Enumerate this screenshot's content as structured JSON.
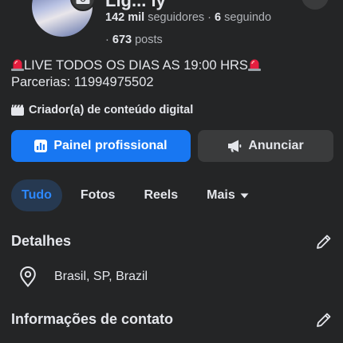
{
  "profile": {
    "name_fragment": "Lig... ly",
    "followers_count": "142 mil",
    "followers_label": "seguidores",
    "separator": "·",
    "following_count": "6",
    "following_label": "seguindo",
    "posts_count": "673",
    "posts_label": "posts"
  },
  "bio": {
    "line1": "LIVE TODOS OS DIAS AS 19:00 HRS",
    "line2": "Parcerias: 11994975502"
  },
  "category": "Criador(a) de conteúdo digital",
  "buttons": {
    "professional_dashboard": "Painel profissional",
    "advertise": "Anunciar"
  },
  "tabs": [
    {
      "label": "Tudo",
      "active": true
    },
    {
      "label": "Fotos",
      "active": false
    },
    {
      "label": "Reels",
      "active": false
    },
    {
      "label": "Mais",
      "active": false
    }
  ],
  "details": {
    "title": "Detalhes",
    "location": "Brasil, SP, Brazil"
  },
  "contact": {
    "title": "Informações de contato"
  },
  "colors": {
    "background": "#242526",
    "primary": "#1877f2",
    "secondary_button": "#3a3b3c",
    "active_tab_bg": "#263951",
    "active_tab_text": "#2d88ff",
    "siren": "#e41e3f"
  }
}
